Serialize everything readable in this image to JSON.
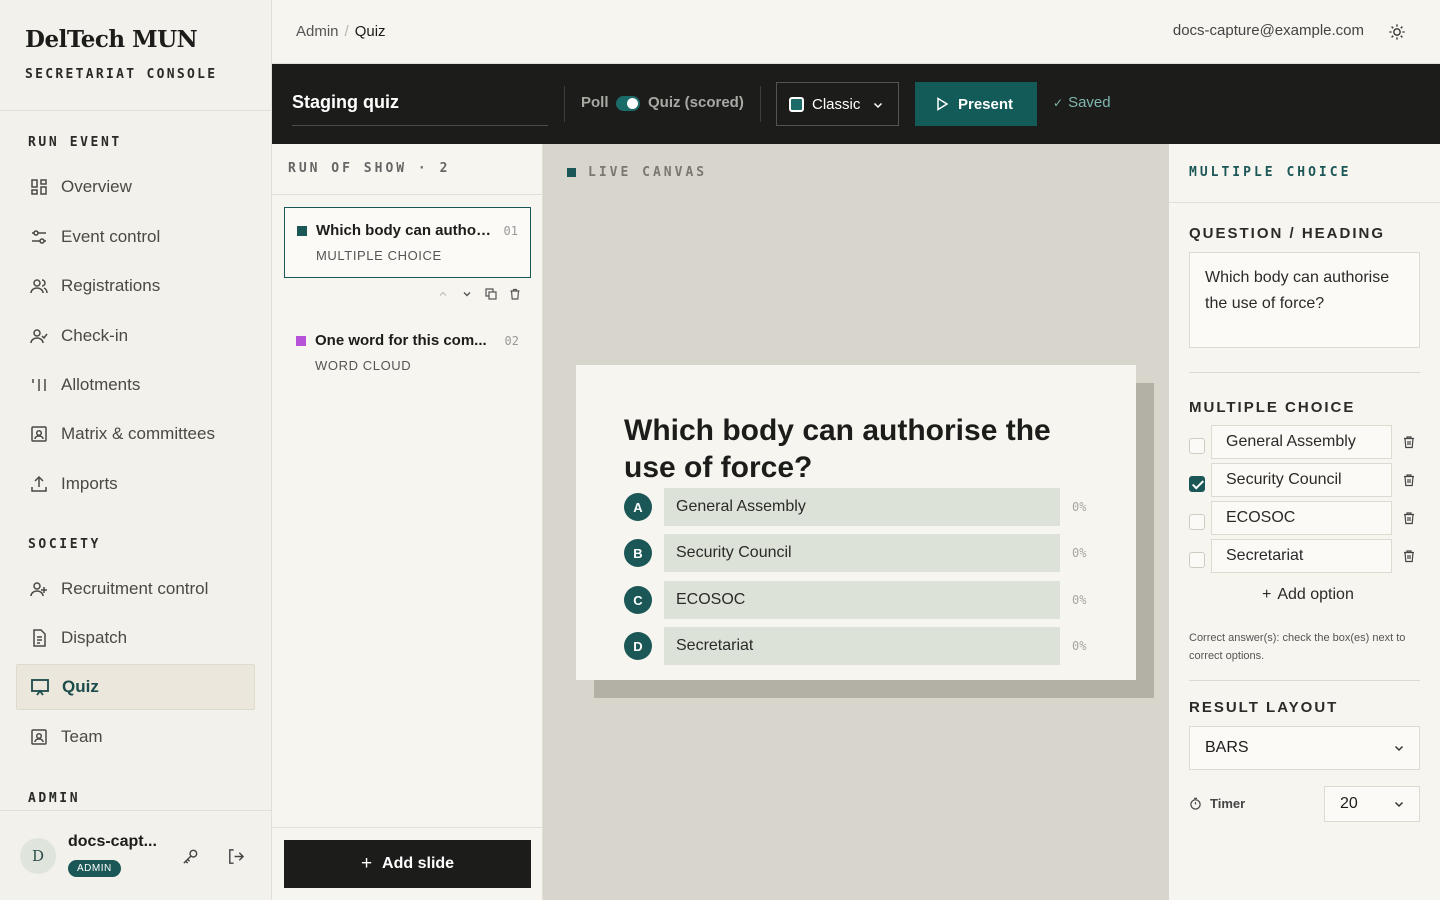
{
  "brand": {
    "name": "DelTech MUN",
    "subtitle": "SECRETARIAT CONSOLE"
  },
  "sidebar": {
    "sections": [
      {
        "label": "RUN EVENT",
        "items": [
          {
            "label": "Overview",
            "icon": "grid-icon"
          },
          {
            "label": "Event control",
            "icon": "sliders-icon"
          },
          {
            "label": "Registrations",
            "icon": "users-icon"
          },
          {
            "label": "Check-in",
            "icon": "user-check-icon"
          },
          {
            "label": "Allotments",
            "icon": "bars-icon"
          },
          {
            "label": "Matrix & committees",
            "icon": "id-card-icon"
          },
          {
            "label": "Imports",
            "icon": "upload-icon"
          }
        ]
      },
      {
        "label": "SOCIETY",
        "items": [
          {
            "label": "Recruitment control",
            "icon": "user-plus-icon"
          },
          {
            "label": "Dispatch",
            "icon": "document-icon"
          },
          {
            "label": "Quiz",
            "icon": "presentation-icon",
            "active": true
          },
          {
            "label": "Team",
            "icon": "id-card-icon"
          }
        ]
      },
      {
        "label": "ADMIN",
        "items": []
      }
    ]
  },
  "user": {
    "initial": "D",
    "name": "docs-capt...",
    "role": "ADMIN"
  },
  "topbar": {
    "breadcrumb": [
      "Admin",
      "Quiz"
    ],
    "email": "docs-capture@example.com"
  },
  "toolbar": {
    "quiz_title": "Staging quiz",
    "mode_poll": "Poll",
    "mode_quiz": "Quiz (scored)",
    "theme": "Classic",
    "present_label": "Present",
    "saved_label": "Saved"
  },
  "run_of_show": {
    "title": "RUN OF SHOW · 2",
    "slides": [
      {
        "title": "Which body can authori...",
        "type": "MULTIPLE CHOICE",
        "num": "01",
        "color": "#1b5756"
      },
      {
        "title": "One word for this com...",
        "type": "WORD CLOUD",
        "num": "02",
        "color": "#b552d9"
      }
    ],
    "add_label": "Add slide"
  },
  "canvas": {
    "label": "LIVE CANVAS",
    "question": "Which body can authorise the use of force?",
    "options": [
      {
        "letter": "A",
        "text": "General Assembly",
        "pct": "0%"
      },
      {
        "letter": "B",
        "text": "Security Council",
        "pct": "0%"
      },
      {
        "letter": "C",
        "text": "ECOSOC",
        "pct": "0%"
      },
      {
        "letter": "D",
        "text": "Secretariat",
        "pct": "0%"
      }
    ]
  },
  "inspector": {
    "title": "MULTIPLE CHOICE",
    "question_label": "QUESTION / HEADING",
    "question_text": "Which body can authorise the use of force?",
    "choices_label": "MULTIPLE CHOICE",
    "choices": [
      {
        "text": "General Assembly",
        "correct": false
      },
      {
        "text": "Security Council",
        "correct": true
      },
      {
        "text": "ECOSOC",
        "correct": false
      },
      {
        "text": "Secretariat",
        "correct": false
      }
    ],
    "add_option_label": "Add option",
    "hint": "Correct answer(s): check the box(es) next to correct options.",
    "result_layout_label": "RESULT LAYOUT",
    "result_layout_value": "BARS",
    "timer_label": "Timer",
    "timer_value": "20"
  }
}
